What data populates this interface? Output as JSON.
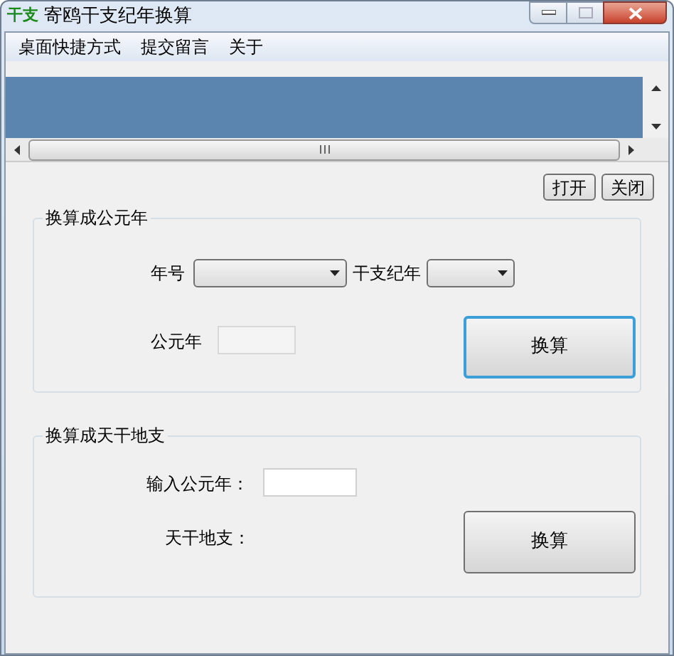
{
  "window": {
    "icon_text": "干支",
    "title": "寄鸥干支纪年换算"
  },
  "menu": [
    "桌面快捷方式",
    "提交留言",
    "关于"
  ],
  "toolbar_buttons": [
    "打开",
    "关闭"
  ],
  "group_to_year": {
    "title": "换算成公元年",
    "era_label": "年号",
    "ganzhi_label": "干支纪年",
    "year_label": "公元年",
    "button": {
      "label": "换算",
      "focused": true
    }
  },
  "group_to_ganzhi": {
    "title": "换算成天干地支",
    "input_label": "输入公元年：",
    "result_label": "天干地支：",
    "button": {
      "label": "换算",
      "focused": false
    }
  }
}
